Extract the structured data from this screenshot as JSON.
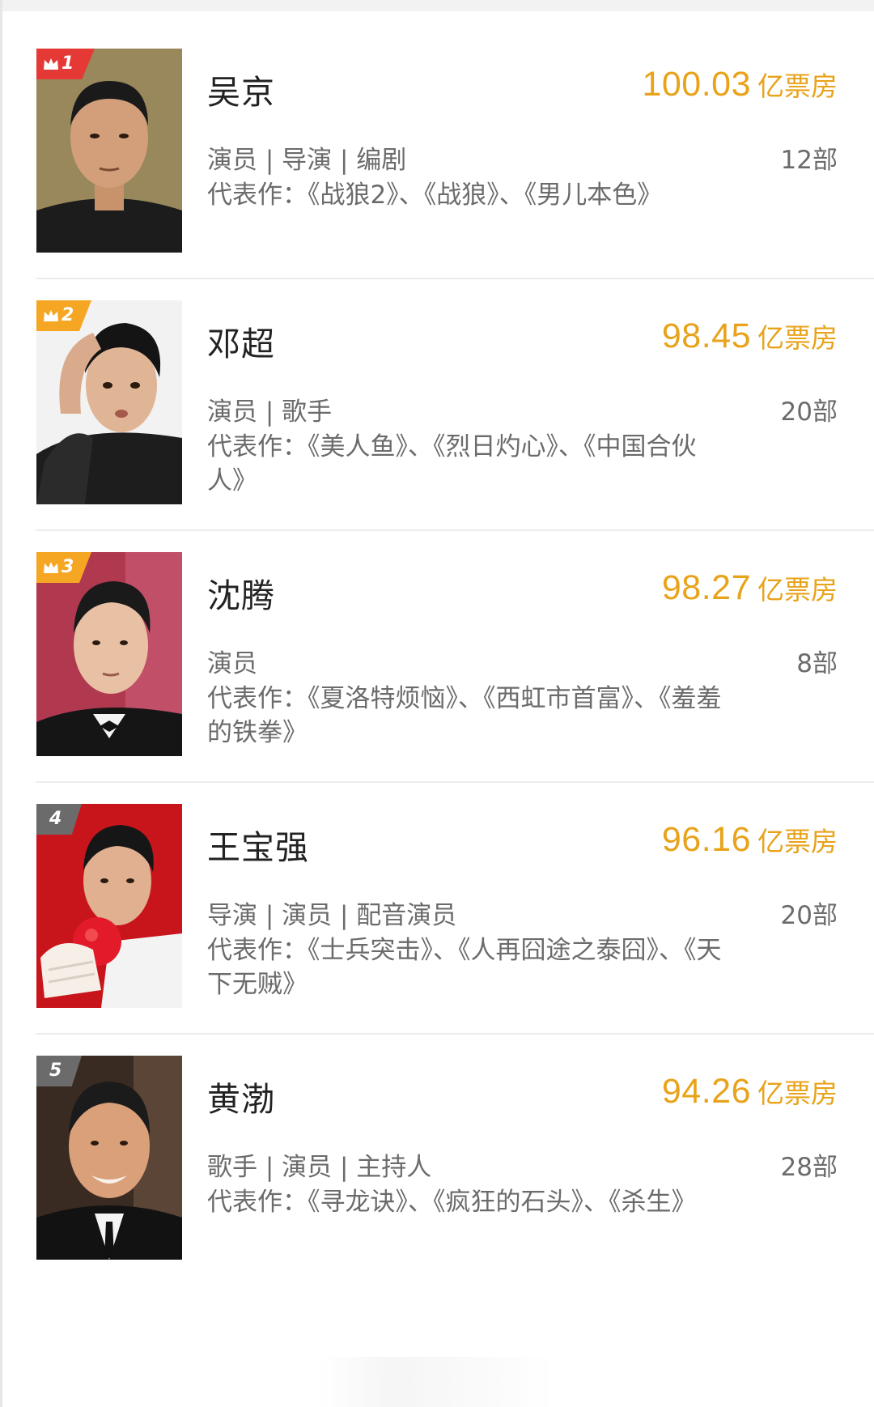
{
  "entries": [
    {
      "rank": "1",
      "name": "吴京",
      "box_office": "100.03",
      "box_office_unit": "亿票房",
      "roles": "演员 | 导演 | 编剧",
      "film_count": "12部",
      "works": "代表作：《战狼2》、《战狼》、《男儿本色》",
      "badge_color": "#e53935"
    },
    {
      "rank": "2",
      "name": "邓超",
      "box_office": "98.45",
      "box_office_unit": "亿票房",
      "roles": "演员 | 歌手",
      "film_count": "20部",
      "works": "代表作：《美人鱼》、《烈日灼心》、《中国合伙人》",
      "badge_color": "#f5a623"
    },
    {
      "rank": "3",
      "name": "沈腾",
      "box_office": "98.27",
      "box_office_unit": "亿票房",
      "roles": "演员",
      "film_count": "8部",
      "works": "代表作：《夏洛特烦恼》、《西虹市首富》、《羞羞的铁拳》",
      "badge_color": "#f5a623"
    },
    {
      "rank": "4",
      "name": "王宝强",
      "box_office": "96.16",
      "box_office_unit": "亿票房",
      "roles": "导演 | 演员 | 配音演员",
      "film_count": "20部",
      "works": "代表作：《士兵突击》、《人再囧途之泰囧》、《天下无贼》",
      "badge_color": "#6b6b6b"
    },
    {
      "rank": "5",
      "name": "黄渤",
      "box_office": "94.26",
      "box_office_unit": "亿票房",
      "roles": "歌手 | 演员 | 主持人",
      "film_count": "28部",
      "works": "代表作：《寻龙诀》、《疯狂的石头》、《杀生》",
      "badge_color": "#6b6b6b"
    }
  ],
  "colors": {
    "accent": "#e8a31a",
    "text_primary": "#222222",
    "text_secondary": "#6b6b6b"
  }
}
